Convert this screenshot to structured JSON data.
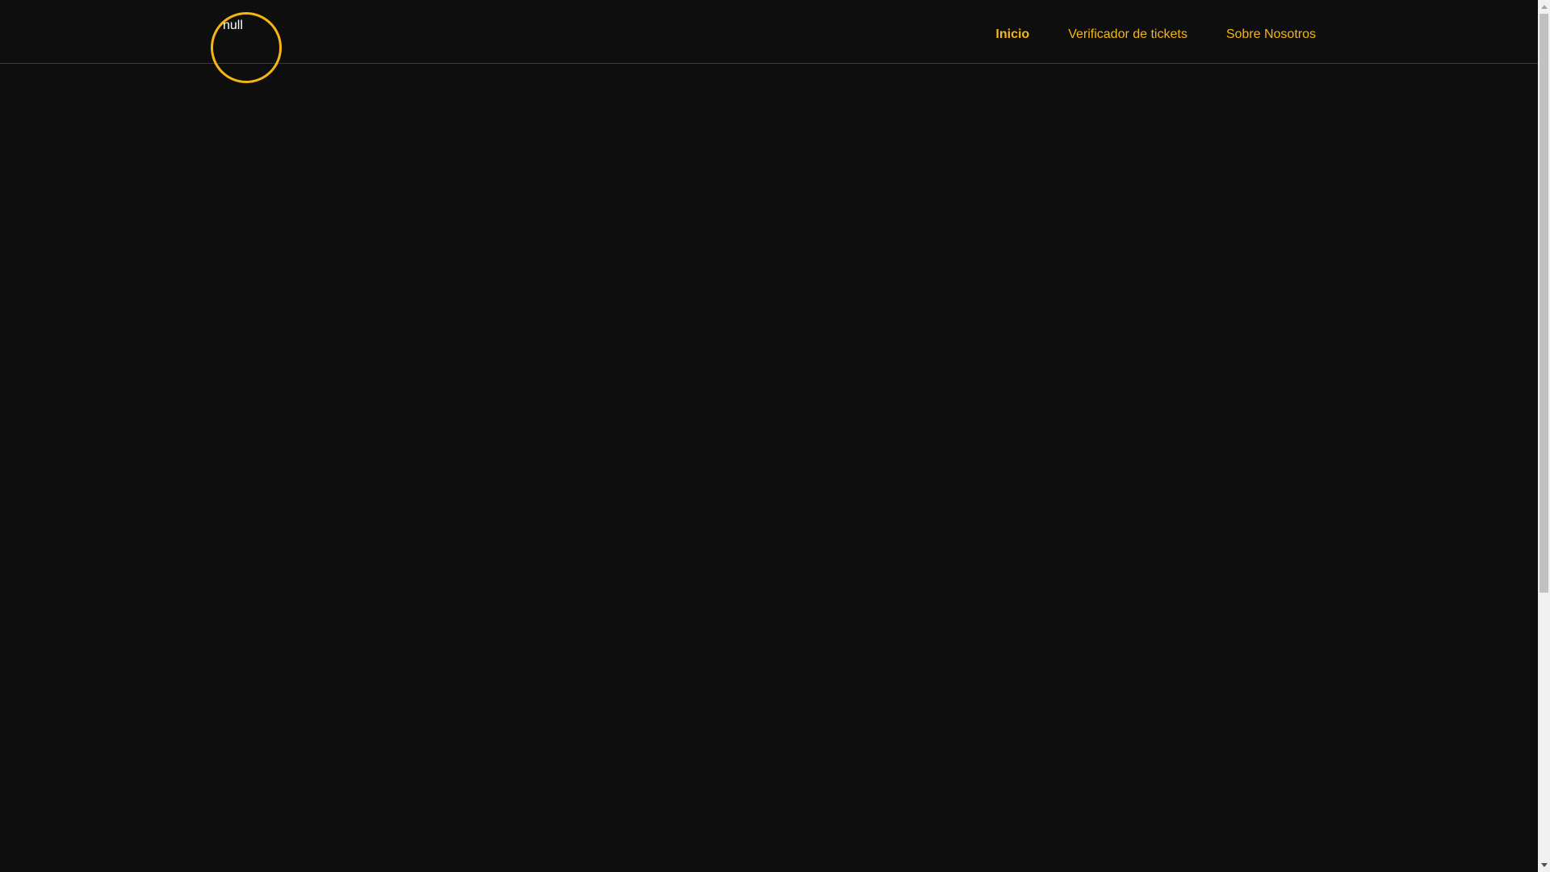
{
  "header": {
    "logo_alt_text": "null",
    "nav": [
      {
        "label": "Inicio",
        "active": true
      },
      {
        "label": "Verificador de tickets",
        "active": false
      },
      {
        "label": "Sobre Nosotros",
        "active": false
      }
    ]
  },
  "colors": {
    "background": "#0e0e0e",
    "accent": "#f5b614",
    "divider": "#3a3a3a"
  }
}
